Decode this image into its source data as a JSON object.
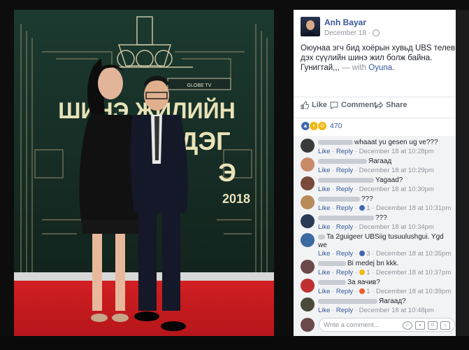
{
  "post": {
    "author": "Anh Bayar",
    "date": "December 18 · ",
    "text": "Оюунаа эгч бид хоёрын хувьд UBS телевиз дэх сүүлийн шинэ жил болж байна. Гунигтай,,, ",
    "with_prefix": "— with ",
    "tagged": "Oyuna",
    "tagged_suffix": "."
  },
  "actions": {
    "like": "Like",
    "comment": "Comment",
    "share": "Share"
  },
  "reactions": {
    "count": "470"
  },
  "photo_sign": {
    "line1": "ШИНЭ ЖИЛИЙН",
    "line2": "ШИЛДЭГ",
    "line3": "Э",
    "year": "2018",
    "badge": "GLOBE TV"
  },
  "comments": [
    {
      "text": "whaaat yu gesen ug ve???",
      "meta_like": "Like",
      "meta_reply": "Reply",
      "meta_time": "December 18 at 10:28pm",
      "avatar_color": "#3a3a3a",
      "reaction": ""
    },
    {
      "text": "Яагаад",
      "meta_like": "Like",
      "meta_reply": "Reply",
      "meta_time": "December 18 at 10:29pm",
      "avatar_color": "#c98a6a",
      "reaction": ""
    },
    {
      "text": "Yagaad?",
      "meta_like": "Like",
      "meta_reply": "Reply",
      "meta_time": "December 18 at 10:30pm",
      "avatar_color": "#7a4a3a",
      "reaction": ""
    },
    {
      "text": "???",
      "meta_like": "Like",
      "meta_reply": "Reply",
      "meta_time": "December 18 at 10:31pm",
      "avatar_color": "#b98a5a",
      "reaction": "1"
    },
    {
      "text": "???",
      "meta_like": "Like",
      "meta_reply": "Reply",
      "meta_time": "December 18 at 10:34pm",
      "avatar_color": "#2a3a55",
      "reaction": ""
    },
    {
      "text": "Ta 2guigeer UBSiig tusuulushgui. Ygd",
      "text2": "we",
      "meta_like": "Like",
      "meta_reply": "Reply",
      "meta_time": "December 18 at 10:35pm",
      "avatar_color": "#3a6aa0",
      "reaction": "3"
    },
    {
      "text": "Bi medej bn kkk.",
      "meta_like": "Like",
      "meta_reply": "Reply",
      "meta_time": "December 18 at 10:37pm",
      "avatar_color": "#6a4a4a",
      "reaction": "1"
    },
    {
      "text": "За яачив?",
      "meta_like": "Like",
      "meta_reply": "Reply",
      "meta_time": "December 18 at 10:39pm",
      "avatar_color": "#c03030",
      "reaction": "1"
    },
    {
      "text": "Яагаад?",
      "meta_like": "Like",
      "meta_reply": "Reply",
      "meta_time": "December 18 at 10:48pm",
      "avatar_color": "#4a4a3a",
      "reaction": ""
    }
  ],
  "write": {
    "placeholder": "Write a comment..."
  },
  "colors": {
    "link": "#365899",
    "gray": "#90949c",
    "like_blue": "#4267b2"
  }
}
